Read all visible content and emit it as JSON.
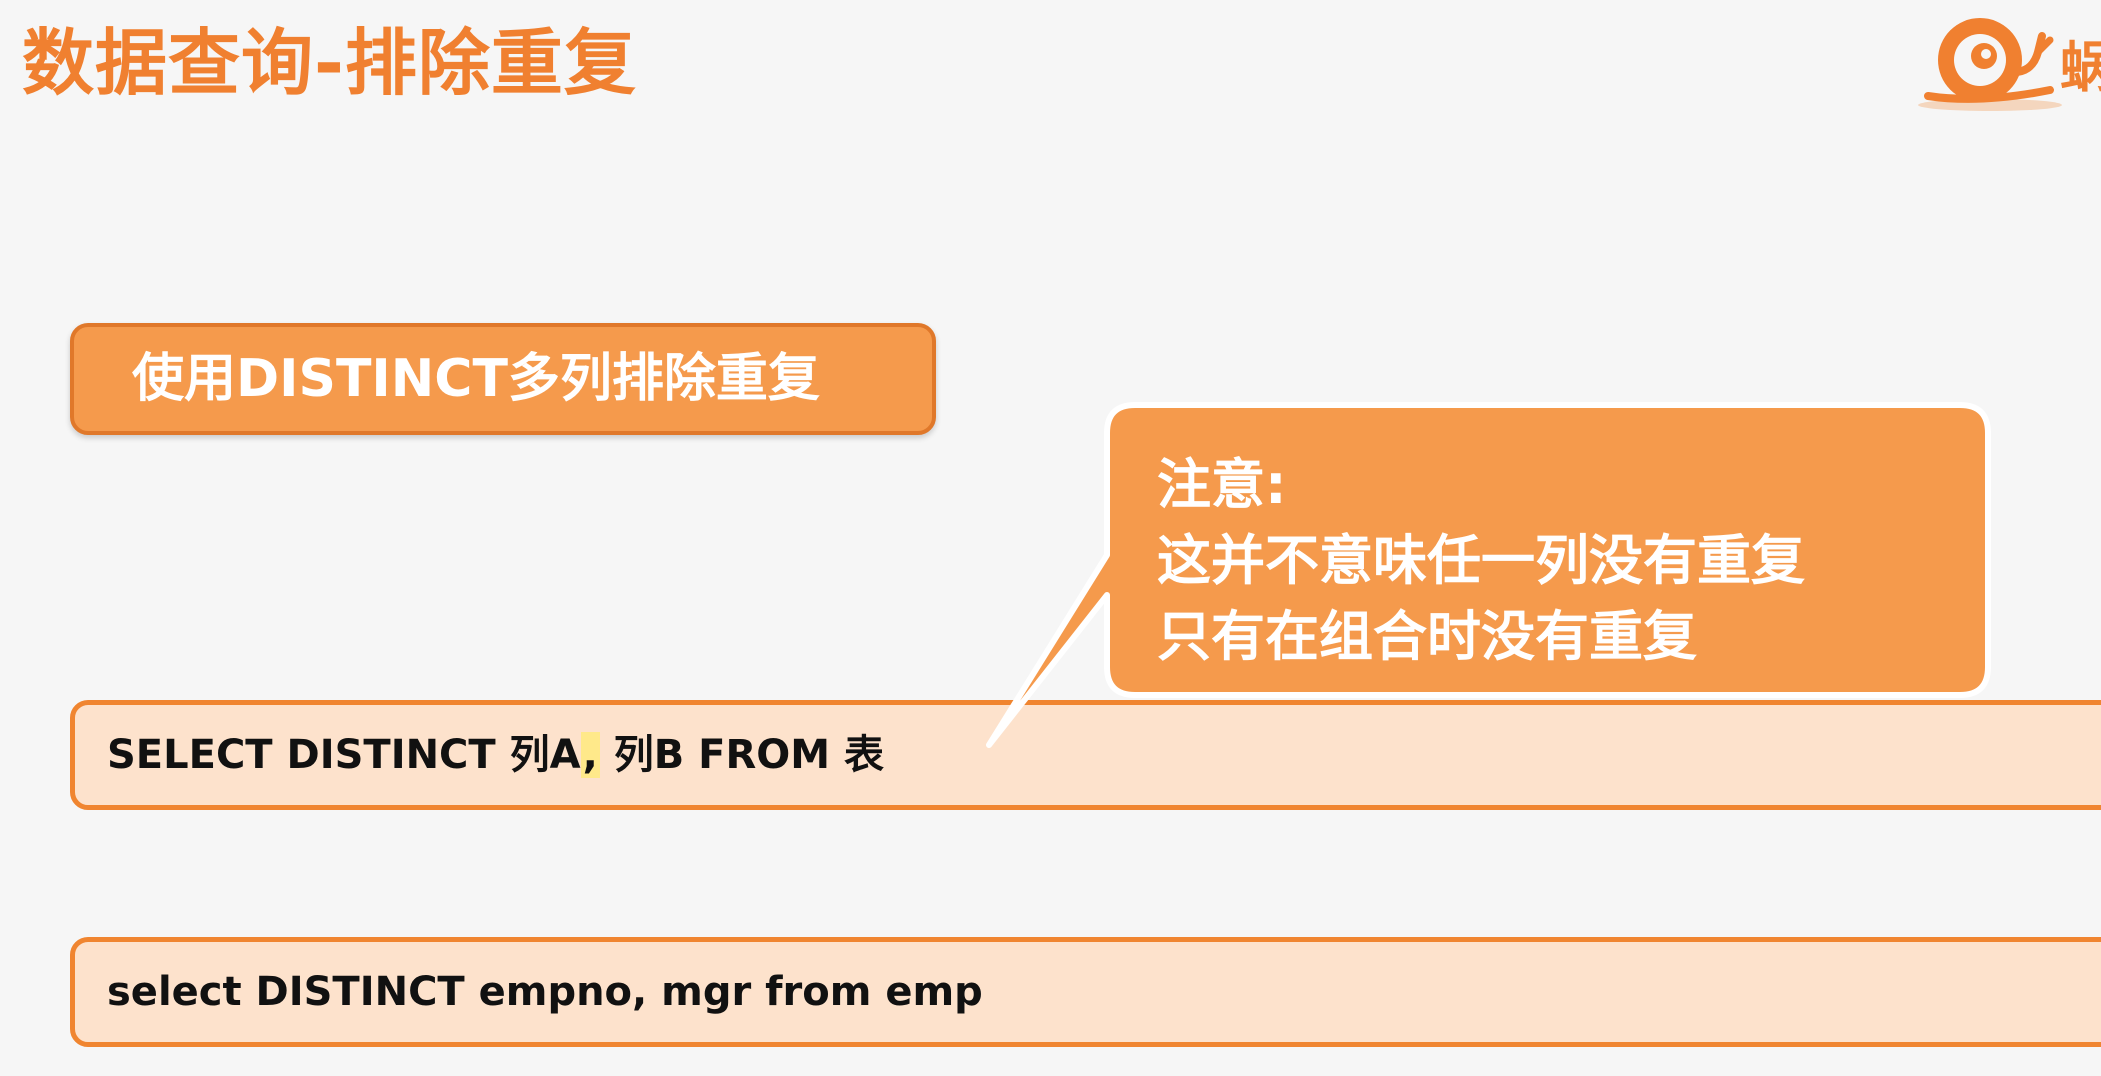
{
  "slide": {
    "title": "数据查询-排除重复",
    "heading": "使用DISTINCT多列排除重复",
    "note": {
      "label": "注意:",
      "line1": "这并不意味任一列没有重复",
      "line2": "只有在组合时没有重复"
    },
    "syntax": {
      "prefix": "SELECT DISTINCT 列A",
      "highlight": ",",
      "suffix": " 列B FROM 表"
    },
    "example": "select DISTINCT empno, mgr from emp",
    "logo": {
      "text": "蜗",
      "icon": "snail-logo-icon"
    }
  },
  "colors": {
    "title": "#f08030",
    "heading_bg": "#f59a4c",
    "callout_bg": "#f59a4c",
    "code_bg": "#fde2cc",
    "code_border": "#f08530"
  }
}
